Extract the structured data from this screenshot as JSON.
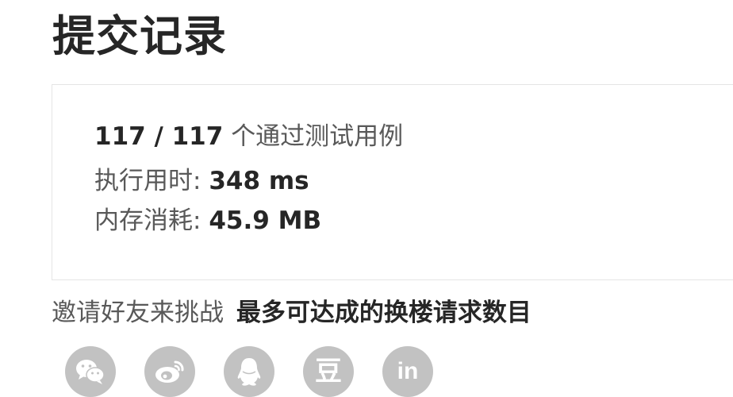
{
  "page": {
    "title": "提交记录"
  },
  "result": {
    "tests_passed": "117 / 117",
    "tests_label": "个通过测试用例",
    "runtime_label": "执行用时:",
    "runtime_value": "348 ms",
    "memory_label": "内存消耗:",
    "memory_value": "45.9 MB"
  },
  "share": {
    "invite_text": "邀请好友来挑战",
    "problem_title": "最多可达成的换楼请求数目",
    "buttons": [
      {
        "icon": "wechat-icon"
      },
      {
        "icon": "weibo-icon"
      },
      {
        "icon": "qq-icon"
      },
      {
        "icon": "douban-icon",
        "glyph": "豆"
      },
      {
        "icon": "linkedin-icon",
        "glyph": "in"
      }
    ]
  },
  "colors": {
    "text_primary": "#262626",
    "text_secondary": "#595959",
    "card_border": "#e5e5e5",
    "social_bg": "#c2c2c2"
  }
}
